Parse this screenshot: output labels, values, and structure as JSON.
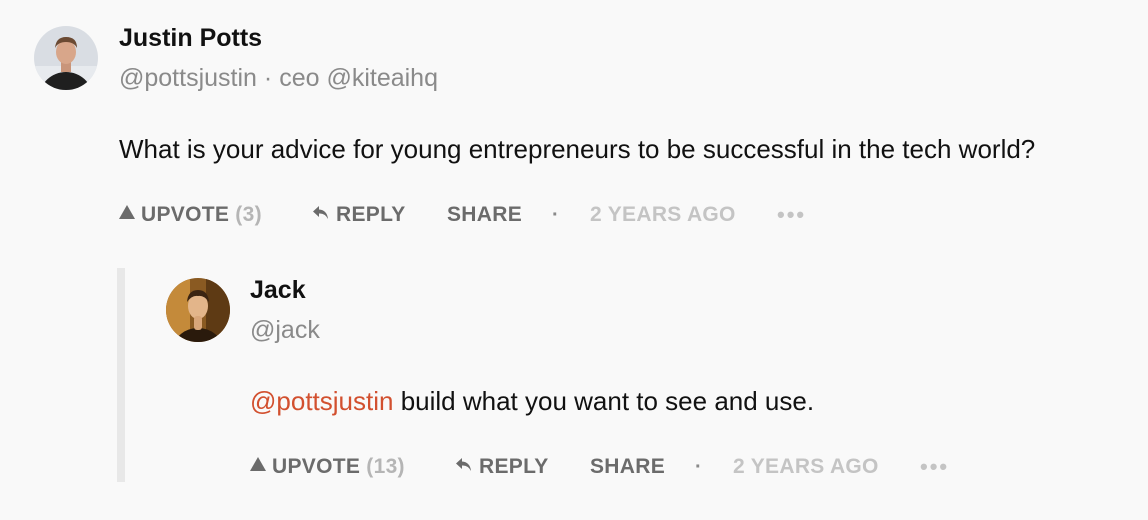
{
  "post": {
    "author_name": "Justin Potts",
    "author_handle": "@pottsjustin",
    "handle_separator": "·",
    "author_title": "ceo @kiteaihq",
    "question": "What is your advice for young entrepreneurs to be successful in the tech world?",
    "actions": {
      "upvote_label": "UPVOTE",
      "upvote_count": "(3)",
      "reply_label": "REPLY",
      "share_label": "SHARE",
      "separator": "·",
      "timestamp": "2 YEARS AGO",
      "more": "•••"
    }
  },
  "reply": {
    "author_name": "Jack",
    "author_handle": "@jack",
    "mention": "@pottsjustin",
    "text": " build what you want to see and use.",
    "actions": {
      "upvote_label": "UPVOTE",
      "upvote_count": "(13)",
      "reply_label": "REPLY",
      "share_label": "SHARE",
      "separator": "·",
      "timestamp": "2 YEARS AGO",
      "more": "•••"
    }
  },
  "colors": {
    "background": "#f9f9f9",
    "mention": "#d2502f",
    "action_text": "#6b6b6b",
    "muted_text": "#c4c4c4",
    "thread_bar": "#e8e8e8"
  },
  "icons": {
    "upvote": "triangle-up-icon",
    "reply": "reply-arrow-icon",
    "more": "more-dots-icon"
  }
}
